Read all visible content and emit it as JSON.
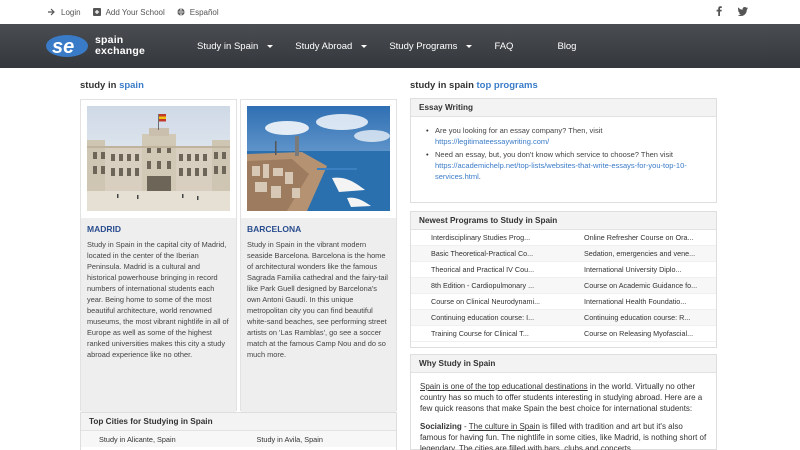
{
  "topbar": {
    "login": "Login",
    "add_school": "Add Your School",
    "language": "Español"
  },
  "brand": {
    "line1": "spain",
    "line2": "exchange"
  },
  "nav": [
    {
      "label": "Study in Spain",
      "dropdown": true
    },
    {
      "label": "Study Abroad",
      "dropdown": true
    },
    {
      "label": "Study Programs",
      "dropdown": true
    },
    {
      "label": "FAQ",
      "dropdown": false
    },
    {
      "label": "Blog",
      "dropdown": false
    }
  ],
  "left": {
    "title_main": "study in ",
    "title_accent": "spain",
    "cards": [
      {
        "city": "MADRID",
        "desc": "Study in Spain in the capital city of Madrid, located in the center of the Iberian Peninsula. Madrid is a cultural and historical powerhouse bringing in record numbers of international students each year. Being home to some of the most beautiful architecture, world renowned museums, the most vibrant nightlife in all of Europe as well as some of the highest ranked universities makes this city a study abroad experience like no other."
      },
      {
        "city": "BARCELONA",
        "desc": "Study in Spain in the vibrant modern seaside Barcelona. Barcelona is the home of architectural wonders like the famous Sagrada Familia cathedral and the fairy-tail like Park Guell designed by Barcelona's own Antoni Gaudí. In this unique metropolitan city you can find beautiful white-sand beaches, see performing street artists on 'Las Ramblas', go see a soccer match at the famous Camp Nou and do so much more."
      }
    ],
    "top_cities": {
      "title": "Top Cities for Studying in Spain",
      "items": [
        "Study in Alicante, Spain",
        "Study in Avila, Spain"
      ]
    }
  },
  "right": {
    "title_main": "study in spain ",
    "title_accent": "top programs",
    "essay": {
      "title": "Essay Writing",
      "items": [
        {
          "text": "Are you looking for an essay company? Then, visit ",
          "link": "https://legitimateessaywriting.com/"
        },
        {
          "text": "Need an essay, but, you don't know which service to choose? Then visit ",
          "link": "https://academichelp.net/top-lists/websites-that-write-essays-for-you-top-10-services.html",
          "suffix": "."
        }
      ]
    },
    "programs": {
      "title": "Newest Programs to Study in Spain",
      "rows": [
        [
          "Interdisciplinary Studies Prog...",
          "Online Refresher Course on Ora..."
        ],
        [
          "Basic Theoretical-Practical Co...",
          "Sedation, emergencies and vene..."
        ],
        [
          "Theorical and Practical IV Cou...",
          "International University Diplo..."
        ],
        [
          "8th Edition - Cardiopulmonary ...",
          "Course on Academic Guidance fo..."
        ],
        [
          "Course on Clinical Neurodynami...",
          "International Health Foundatio..."
        ],
        [
          "Continuing education course: I...",
          "Continuing education course: R..."
        ],
        [
          "Training Course for Clinical T...",
          "Course on Releasing Myofascial..."
        ]
      ]
    },
    "why": {
      "title": "Why Study in Spain",
      "p1_link": "Spain is one of the top educational destinations",
      "p1_rest": " in the world. Virtually no other country has so much to offer students interesting in studying abroad. Here are a few quick reasons that make Spain the best choice for international students:",
      "p2_bold": "Socializing",
      "p2_dash": " - ",
      "p2_link": "The culture in Spain",
      "p2_rest": " is filled with tradition and art but it's also famous for having fun. The nightlife in some cities, like Madrid, is nothing short of legendary. The cities are filled with bars, clubs and concerts."
    }
  }
}
